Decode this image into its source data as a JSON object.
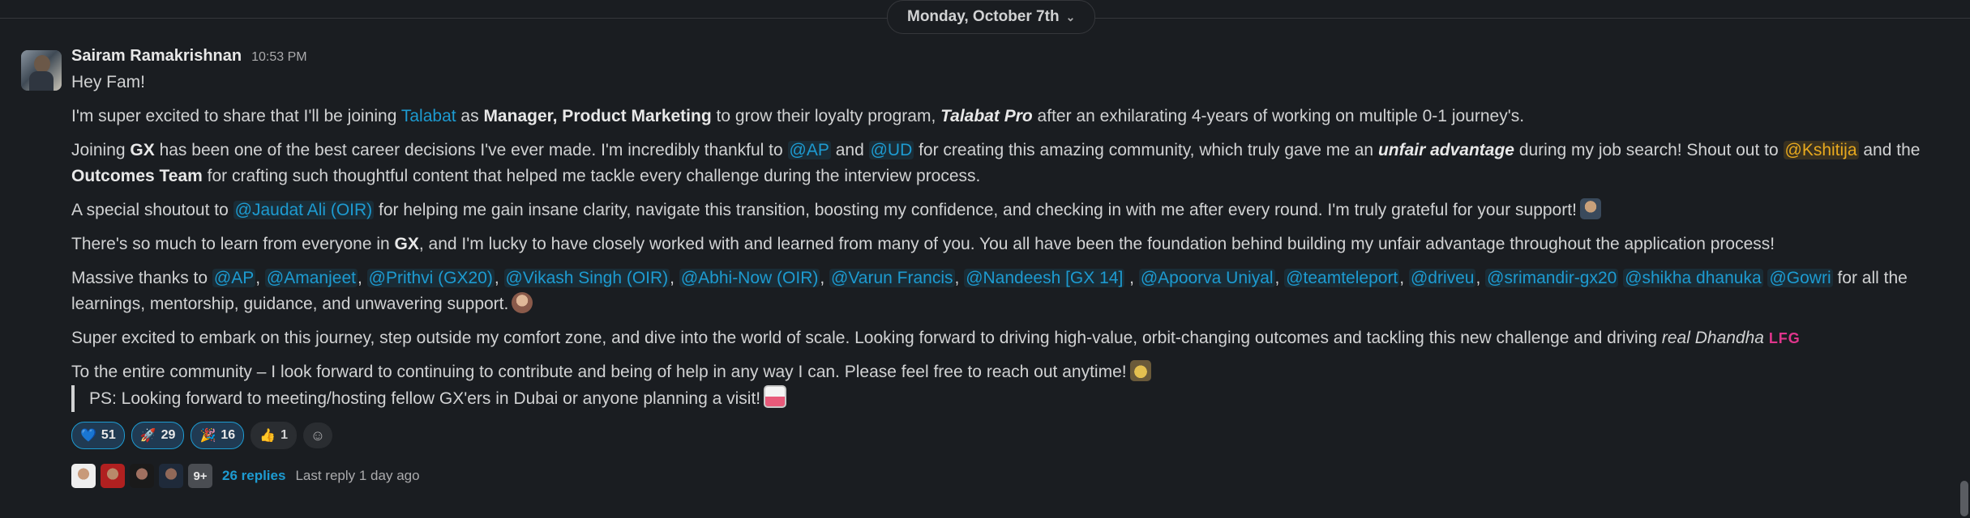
{
  "date_divider": {
    "label": "Monday, October 7th"
  },
  "message": {
    "sender": "Sairam Ramakrishnan",
    "time": "10:53 PM",
    "greeting": "Hey Fam!",
    "p1": {
      "a": "I'm super excited to share that I'll be joining ",
      "company": "Talabat",
      "b": " as ",
      "role": "Manager, Product Marketing",
      "c": " to grow their loyalty program, ",
      "program": "Talabat Pro",
      "d": " after an exhilarating 4-years of working on multiple 0-1 journey's."
    },
    "p2": {
      "a": "Joining ",
      "gx": "GX",
      "b": " has been one of the best career decisions I've ever made. I'm incredibly thankful to ",
      "m1": "@AP",
      "c": " and ",
      "m2": "@UD",
      "d": " for creating this amazing community, which truly gave me an ",
      "unfair": "unfair advantage",
      "e": " during my job search! Shout out to ",
      "m3": "@Kshitija",
      "f": " and the ",
      "team": "Outcomes Team",
      "g": " for crafting such thoughtful content that helped me tackle every challenge during the interview process."
    },
    "p3": {
      "a": "A special shoutout to ",
      "m1": "@Jaudat Ali (OIR)",
      "b": " for helping me gain insane clarity, navigate this transition, boosting my confidence, and checking in with me after every round.  I'm truly grateful for your support!"
    },
    "p4": {
      "a": "There's so much to learn from everyone in ",
      "gx": "GX",
      "b": ", and I'm lucky to have closely worked with and learned from many of you. You all have been the foundation behind building my unfair advantage throughout the application process!"
    },
    "p5": {
      "a": "Massive thanks to ",
      "mentions": [
        "@AP",
        "@Amanjeet",
        "@Prithvi (GX20)",
        "@Vikash Singh (OIR)",
        "@Abhi-Now (OIR)",
        "@Varun Francis",
        "@Nandeesh [GX 14]",
        "@Apoorva Uniyal",
        "@teamteleport",
        "@driveu",
        "@srimandir-gx20",
        "@shikha dhanuka",
        "@Gowri"
      ],
      "b": " for all the learnings, mentorship, guidance, and unwavering support."
    },
    "p6": {
      "a": "Super excited to embark on this journey, step outside my comfort zone, and dive into the world of scale. Looking forward to driving high-value, orbit-changing outcomes and tackling this new challenge and  driving ",
      "em": "real Dhandha",
      "lfg": "LFG"
    },
    "p7": "To the entire community – I look forward to continuing to contribute and being of help in any way I can. Please feel free to reach out anytime!",
    "quote": "PS: Looking forward to meeting/hosting fellow GX'ers in Dubai or anyone planning a visit!",
    "reactions": [
      {
        "icon": "💙",
        "icon_name": "blue-heart-icon",
        "count": "51"
      },
      {
        "icon": "🚀",
        "icon_name": "rocket-icon",
        "count": "29"
      },
      {
        "icon": "🎉",
        "icon_name": "custom-emoji-icon",
        "count": "16"
      },
      {
        "icon": "👍",
        "icon_name": "thumbs-up-icon",
        "count": "1"
      }
    ],
    "add_reaction_icon": "add-reaction-icon",
    "thread": {
      "more_label": "9+",
      "replies_label": "26 replies",
      "last_reply": "Last reply 1 day ago"
    }
  },
  "colors": {
    "background": "#1a1d21",
    "link": "#1d9bd1",
    "self_mention": "#e8a91e",
    "lfg": "#e0358c"
  }
}
